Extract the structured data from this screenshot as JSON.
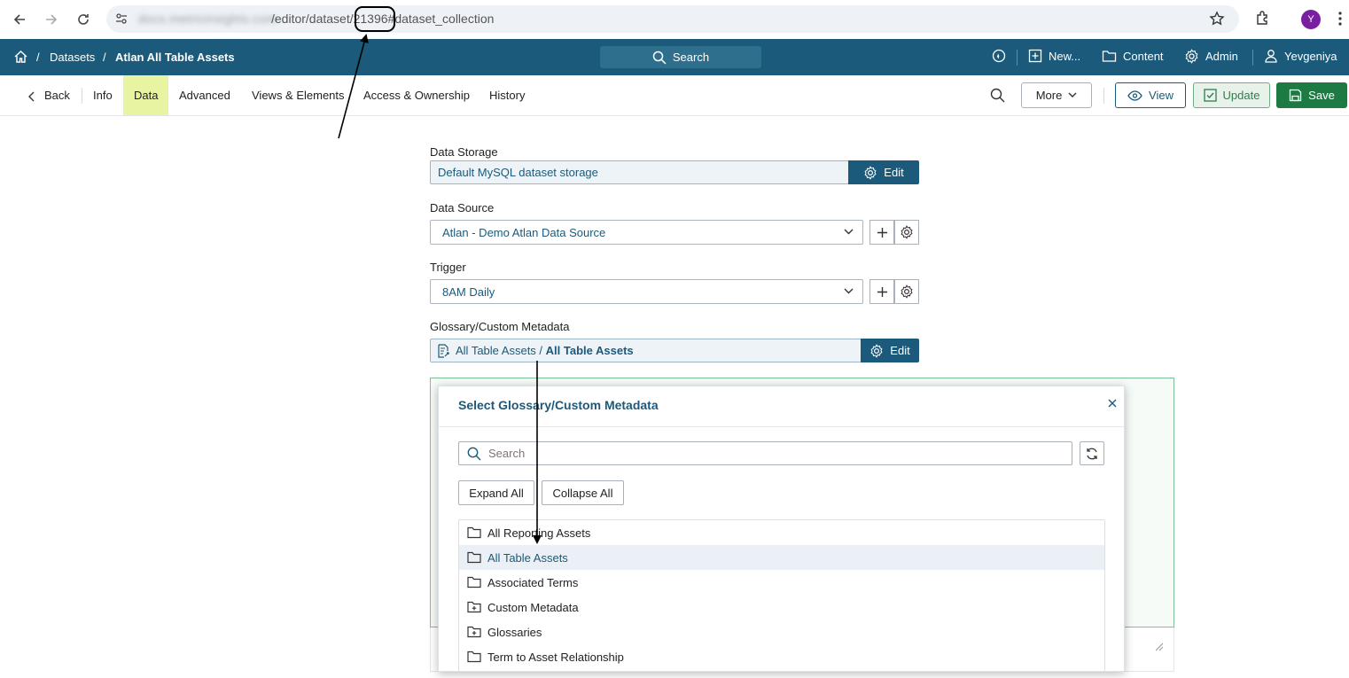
{
  "browser": {
    "url_host": "docs.metricinsights.com",
    "url_path": "/editor/dataset/21396#dataset_collection",
    "profile_initial": "Y"
  },
  "header": {
    "breadcrumbs": [
      "Datasets",
      "/",
      "Atlan All Table Assets"
    ],
    "search_label": "Search",
    "new_label": "New...",
    "content_label": "Content",
    "admin_label": "Admin",
    "user_label": "Yevgeniya",
    "color": "#1b5a7a"
  },
  "toolbar": {
    "back_label": "Back",
    "tabs": [
      "Info",
      "Data",
      "Advanced",
      "Views & Elements",
      "Access & Ownership",
      "History"
    ],
    "active_tab": "Data",
    "more_label": "More",
    "view_label": "View",
    "update_label": "Update",
    "save_label": "Save"
  },
  "form": {
    "data_storage": {
      "label": "Data Storage",
      "value": "Default MySQL dataset storage",
      "edit_label": "Edit"
    },
    "data_source": {
      "label": "Data Source",
      "value": "Atlan - Demo Atlan Data Source"
    },
    "trigger": {
      "label": "Trigger",
      "value": "8AM Daily"
    },
    "glossary": {
      "label": "Glossary/Custom Metadata",
      "path_prefix": "All Table Assets / ",
      "path_bold": "All Table Assets",
      "edit_label": "Edit"
    }
  },
  "modal": {
    "title": "Select Glossary/Custom Metadata",
    "search_placeholder": "Search",
    "expand_label": "Expand All",
    "collapse_label": "Collapse All",
    "items": [
      {
        "label": "All Reporting Assets",
        "icon": "folder-icon"
      },
      {
        "label": "All Table Assets",
        "icon": "folder-icon",
        "selected": true
      },
      {
        "label": "Associated Terms",
        "icon": "folder-icon"
      },
      {
        "label": "Custom Metadata",
        "icon": "folder-plus-icon"
      },
      {
        "label": "Glossaries",
        "icon": "folder-plus-icon"
      },
      {
        "label": "Term to Asset Relationship",
        "icon": "folder-icon"
      }
    ]
  }
}
